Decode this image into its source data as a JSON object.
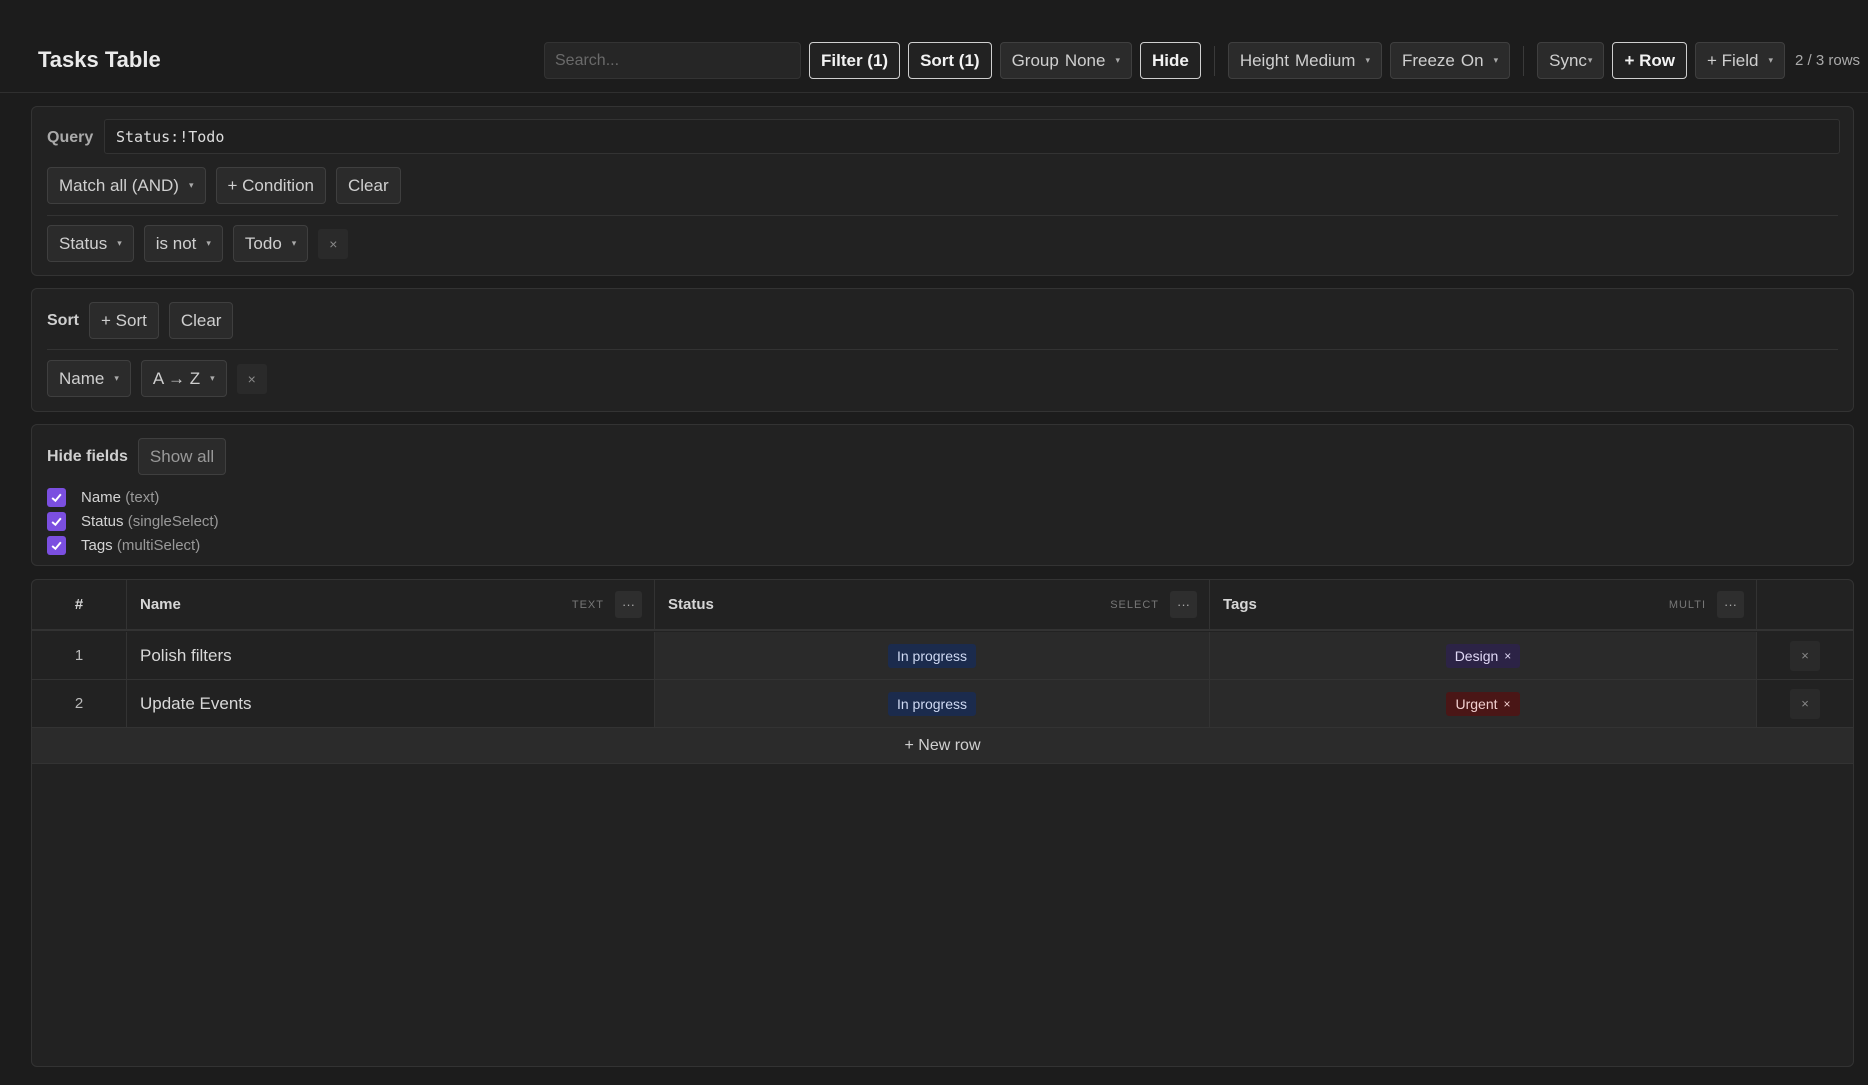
{
  "header": {
    "title": "Tasks Table",
    "search_placeholder": "Search...",
    "filter_label": "Filter (1)",
    "sort_label": "Sort (1)",
    "group_label": "Group",
    "group_value": "None",
    "hide_label": "Hide",
    "height_label": "Height",
    "height_value": "Medium",
    "freeze_label": "Freeze",
    "freeze_value": "On",
    "sync_label": "Sync",
    "add_row_label": "+ Row",
    "add_field_label": "+ Field",
    "row_count": "2 / 3 rows"
  },
  "query": {
    "label": "Query",
    "value": "Status:!Todo",
    "match_mode": "Match all (AND)",
    "add_condition_label": "+ Condition",
    "clear_label": "Clear",
    "conditions": [
      {
        "field": "Status",
        "operator": "is not",
        "value": "Todo"
      }
    ]
  },
  "sort": {
    "label": "Sort",
    "add_label": "+ Sort",
    "clear_label": "Clear",
    "rules": [
      {
        "field": "Name",
        "direction": "A → Z"
      }
    ]
  },
  "hide": {
    "label": "Hide fields",
    "show_all_label": "Show all",
    "fields": [
      {
        "name": "Name",
        "type": "(text)",
        "checked": true
      },
      {
        "name": "Status",
        "type": "(singleSelect)",
        "checked": true
      },
      {
        "name": "Tags",
        "type": "(multiSelect)",
        "checked": true
      }
    ]
  },
  "table": {
    "columns": [
      {
        "label": "#",
        "type": ""
      },
      {
        "label": "Name",
        "type": "TEXT"
      },
      {
        "label": "Status",
        "type": "SELECT"
      },
      {
        "label": "Tags",
        "type": "MULTI"
      }
    ],
    "rows": [
      {
        "num": "1",
        "name": "Polish filters",
        "status": "In progress",
        "tag": "Design",
        "tag_color": "#2c2346"
      },
      {
        "num": "2",
        "name": "Update Events",
        "status": "In progress",
        "tag": "Urgent",
        "tag_color": "#4a1616"
      }
    ],
    "new_row_label": "+ New row",
    "menu_glyph": "···",
    "remove_glyph": "×"
  },
  "colors": {
    "accent": "#7b4fe0",
    "status_in_progress": "#1b2b4d"
  }
}
